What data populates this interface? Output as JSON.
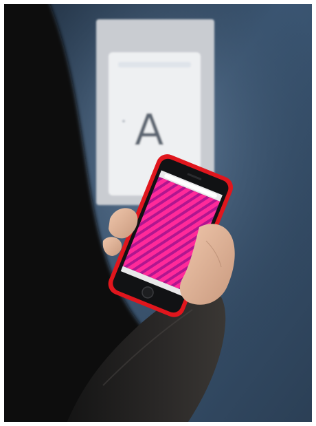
{
  "scene": {
    "description_type": "photo",
    "wall_display": {
      "letter": "A",
      "frame_color": "#c9ccd1",
      "screen_color": "#eef0f2"
    },
    "phone": {
      "case_color": "#e0161d",
      "screen_pattern_colors": [
        "#ff1f8f",
        "#a0148a"
      ]
    },
    "palette": {
      "background_wall": "#3e5670",
      "jacket": "#2e2c2b",
      "hand": "#e2b79c"
    }
  }
}
